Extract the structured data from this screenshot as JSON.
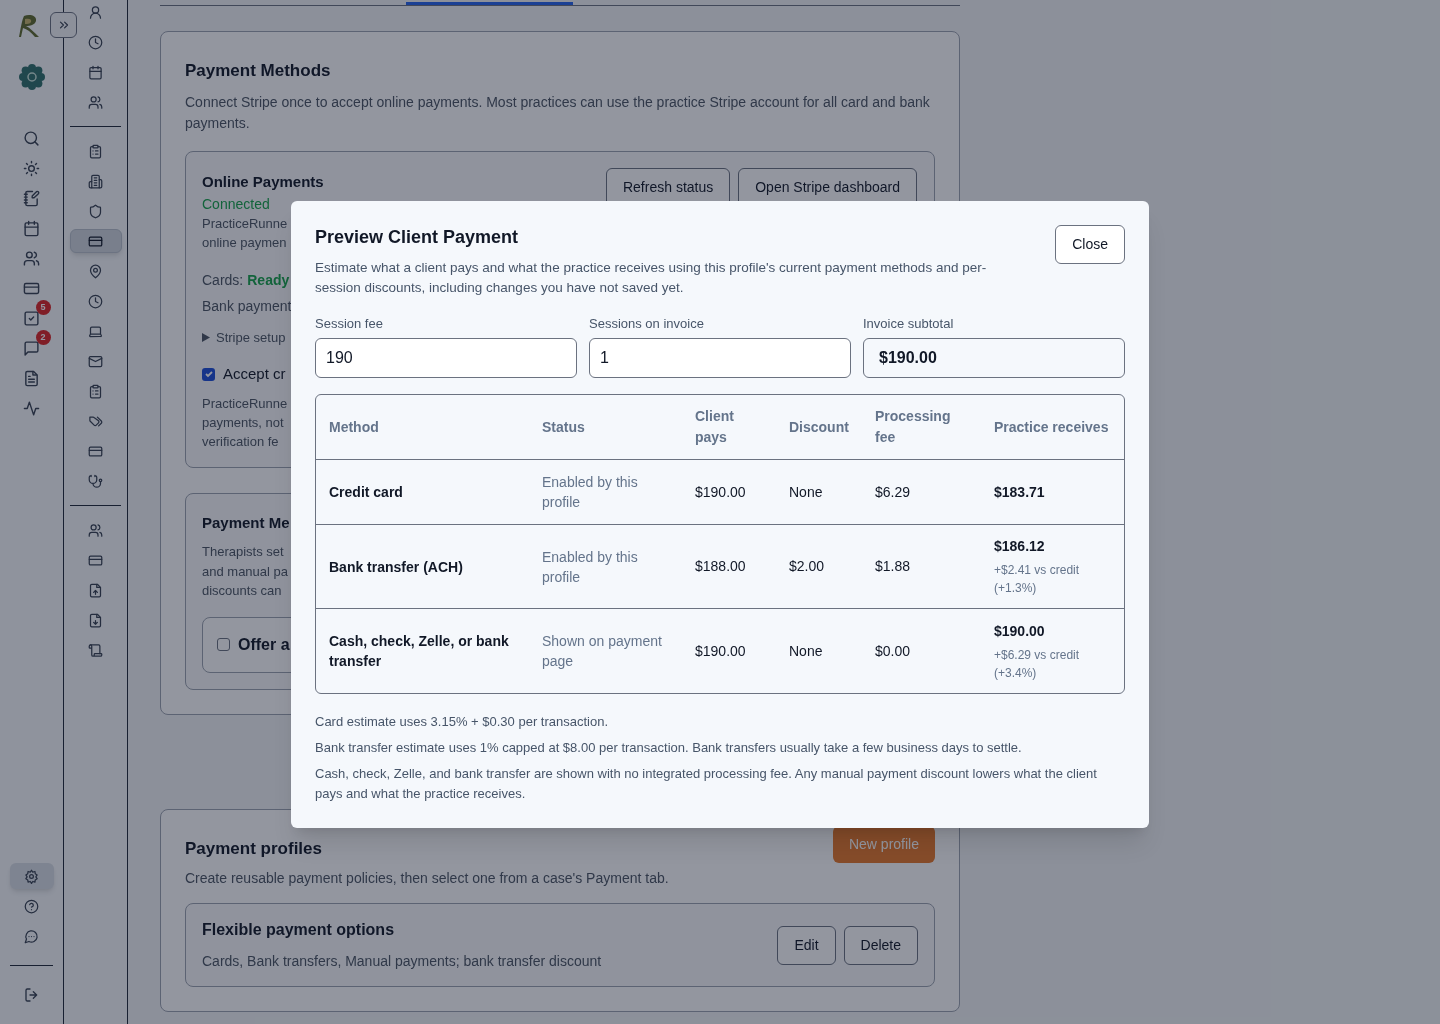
{
  "primary_rail": {
    "items": [
      {
        "selected": false
      },
      {
        "selected": false
      },
      {
        "selected": false
      },
      {
        "selected": false
      },
      {
        "selected": false
      },
      {
        "selected": false
      },
      {
        "selected": false,
        "badge": "5"
      },
      {
        "selected": false,
        "badge": "2"
      },
      {
        "selected": false
      },
      {
        "selected": false
      }
    ],
    "footer_items": [
      {
        "selected": true
      },
      {
        "selected": false
      },
      {
        "selected": false
      }
    ],
    "logout": {
      "selected": false
    }
  },
  "secondary_rail": {
    "groups": [
      [
        {
          "selected": false
        },
        {
          "selected": false
        },
        {
          "selected": false
        },
        {
          "selected": false
        }
      ],
      [
        {
          "selected": false
        },
        {
          "selected": false
        },
        {
          "selected": false
        },
        {
          "selected": true
        },
        {
          "selected": false
        },
        {
          "selected": false
        },
        {
          "selected": false
        },
        {
          "selected": false
        },
        {
          "selected": false
        },
        {
          "selected": false
        },
        {
          "selected": false
        },
        {
          "selected": false
        }
      ],
      [
        {
          "selected": false
        },
        {
          "selected": false
        },
        {
          "selected": false
        },
        {
          "selected": false
        },
        {
          "selected": false
        }
      ]
    ]
  },
  "payment_methods": {
    "title": "Payment Methods",
    "description": "Connect Stripe once to accept online payments. Most practices can use the practice Stripe account for all card and bank payments.",
    "online_payments": {
      "title": "Online Payments",
      "status": "Connected",
      "intro_lines": [
        "PracticeRunne",
        "online paymen"
      ],
      "cards_label": "Cards:",
      "cards_status": "Ready",
      "bank_line": "Bank payment",
      "disclosure": {
        "label": "Stripe setup",
        "expanded": false
      },
      "checkbox": {
        "label": "Accept cr",
        "checked": true
      },
      "note_lines": [
        "PracticeRunne",
        "payments, not",
        "verification fe"
      ],
      "buttons": [
        "Refresh status",
        "Open Stripe dashboard"
      ]
    },
    "manual_payments": {
      "title": "Payment Me",
      "description_lines": [
        "Therapists set",
        "and manual pa",
        "discounts can"
      ],
      "checkbox": {
        "label": "Offer a",
        "checked": false
      }
    }
  },
  "payment_profiles": {
    "title": "Payment profiles",
    "description": "Create reusable payment policies, then select one from a case's Payment tab.",
    "new_button": "New profile",
    "profiles": [
      {
        "title": "Flexible payment options",
        "summary": "Cards, Bank transfers, Manual payments; bank transfer discount",
        "buttons": [
          "Edit",
          "Delete"
        ]
      }
    ]
  },
  "modal": {
    "title": "Preview Client Payment",
    "description": "Estimate what a client pays and what the practice receives using this profile's current payment methods and per-session discounts, including changes you have not saved yet.",
    "close": "Close",
    "fields": [
      {
        "label": "Session fee",
        "value": "190",
        "readonly": false
      },
      {
        "label": "Sessions on invoice",
        "value": "1",
        "readonly": false
      },
      {
        "label": "Invoice subtotal",
        "value": "$190.00",
        "readonly": true
      }
    ],
    "table": {
      "columns": [
        "Method",
        "Status",
        "Client pays",
        "Discount",
        "Processing fee",
        "Practice receives"
      ],
      "rows": [
        {
          "method": "Credit card",
          "status": "Enabled by this profile",
          "client_pays": "$190.00",
          "discount": "None",
          "processing_fee": "$6.29",
          "practice_receives": "$183.71"
        },
        {
          "method": "Bank transfer (ACH)",
          "status": "Enabled by this profile",
          "client_pays": "$188.00",
          "discount": "$2.00",
          "processing_fee": "$1.88",
          "practice_receives": "$186.12",
          "comparison": "+$2.41 vs credit (+1.3%)"
        },
        {
          "method": "Cash, check, Zelle, or bank transfer",
          "status": "Shown on payment page",
          "client_pays": "$190.00",
          "discount": "None",
          "processing_fee": "$0.00",
          "practice_receives": "$190.00",
          "comparison": "+$6.29 vs credit (+3.4%)"
        }
      ]
    },
    "notes": [
      "Card estimate uses 3.15% + $0.30 per transaction.",
      "Bank transfer estimate uses 1% capped at $8.00 per transaction. Bank transfers usually take a few business days to settle.",
      "Cash, check, Zelle, and bank transfer are shown with no integrated processing fee. Any manual payment discount lowers what the client pays and what the practice receives."
    ]
  }
}
